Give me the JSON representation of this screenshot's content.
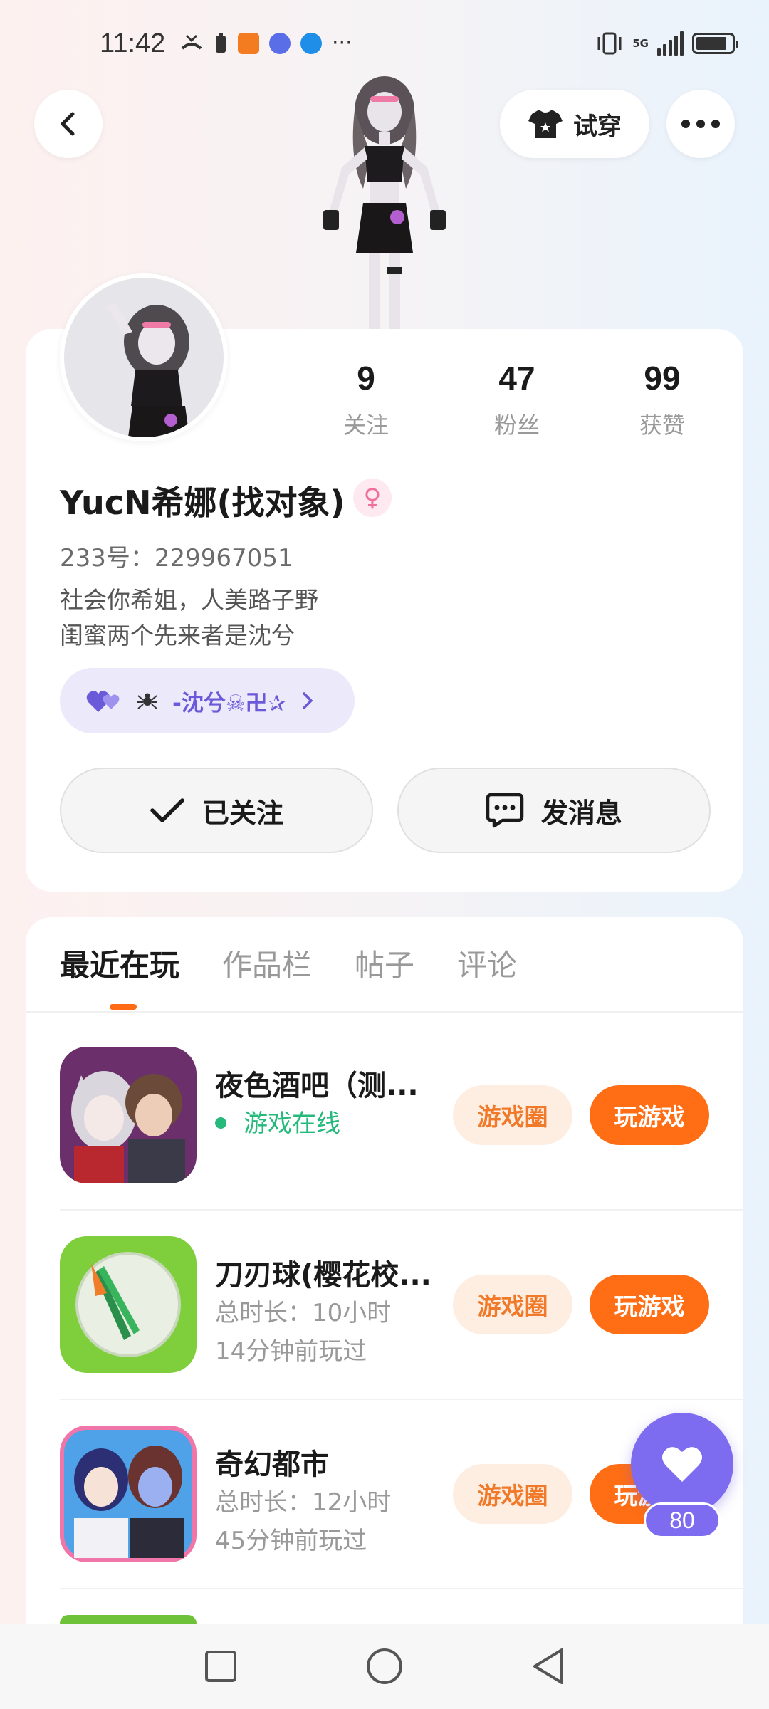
{
  "status_bar": {
    "time": "11:42",
    "network": "5G",
    "icons": [
      "missed-call-icon",
      "battery-saver-icon",
      "app-notification-icon",
      "music-icon",
      "browser-icon",
      "more-notifications-icon",
      "vibrate-icon",
      "signal-icon",
      "battery-icon"
    ]
  },
  "header": {
    "tryon_label": "试穿"
  },
  "profile": {
    "stats": [
      {
        "value": "9",
        "label": "关注"
      },
      {
        "value": "47",
        "label": "粉丝"
      },
      {
        "value": "99",
        "label": "获赞"
      }
    ],
    "username": "YucN希娜(找对象)",
    "uid": "233号：229967051",
    "bio_lines": [
      "社会你希姐，人美路子野",
      "闺蜜两个先来者是沈兮"
    ],
    "guild_chip": "-沈兮☠卍✰",
    "follow_button": "已关注",
    "message_button": "发消息"
  },
  "tabs": [
    {
      "label": "最近在玩",
      "active": true
    },
    {
      "label": "作品栏",
      "active": false
    },
    {
      "label": "帖子",
      "active": false
    },
    {
      "label": "评论",
      "active": false
    }
  ],
  "games": [
    {
      "title": "夜色酒吧（测...",
      "line1": "游戏在线",
      "line2": "",
      "circle_label": "游戏圈",
      "play_label": "玩游戏"
    },
    {
      "title": "刀刃球(樱花校...",
      "line1": "总时长：10小时",
      "line2": "14分钟前玩过",
      "circle_label": "游戏圈",
      "play_label": "玩游戏"
    },
    {
      "title": "奇幻都市",
      "line1": "总时长：12小时",
      "line2": "45分钟前玩过",
      "circle_label": "游戏圈",
      "play_label": "玩游戏"
    }
  ],
  "floating_like": {
    "count": "80"
  },
  "colors": {
    "accent_orange": "#ff6e14",
    "online_green": "#26b97c",
    "purple": "#7d6cf0"
  }
}
